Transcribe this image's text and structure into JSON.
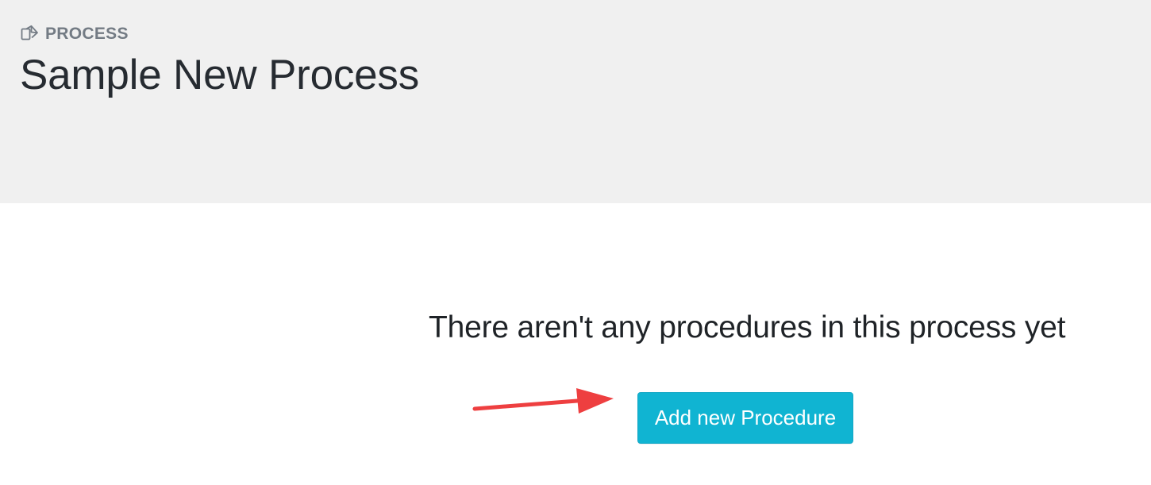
{
  "header": {
    "section_label": "PROCESS",
    "section_icon": "process-copy-icon",
    "title": "Sample New Process"
  },
  "main": {
    "empty_message": "There aren't any procedures in this process yet",
    "add_button_label": "Add new Procedure"
  },
  "annotation": {
    "arrow_icon": "red-pointer-arrow-icon"
  },
  "colors": {
    "header_background": "#f0f0f0",
    "section_label": "#737b84",
    "title_text": "#262b31",
    "button_background": "#10b4d2",
    "button_text": "#ffffff",
    "annotation_arrow": "#ee3f40"
  }
}
